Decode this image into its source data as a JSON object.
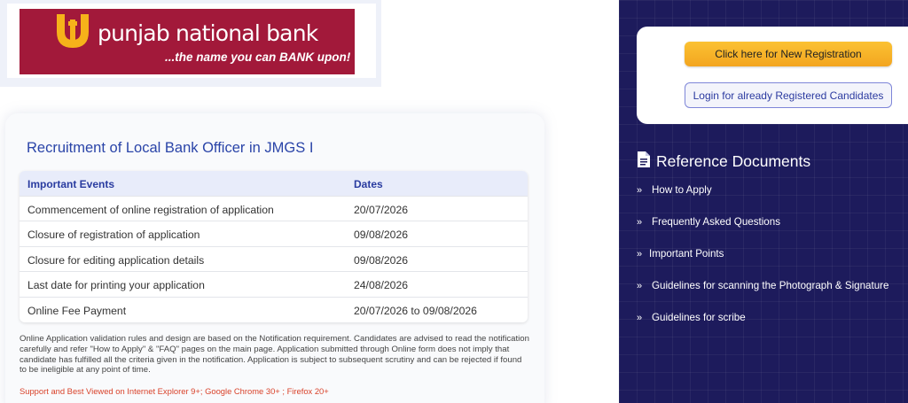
{
  "brand": {
    "name": "punjab national bank",
    "tagline": "...the name you can BANK upon!",
    "color": "#a2193a",
    "emblem_color": "#f6b21a"
  },
  "main": {
    "title": "Recruitment of Local Bank Officer in JMGS I",
    "table": {
      "headers": [
        "Important Events",
        "Dates"
      ],
      "rows": [
        [
          "Commencement of online registration of application",
          "20/07/2026"
        ],
        [
          "Closure of registration of application",
          "09/08/2026"
        ],
        [
          "Closure for editing application details",
          "09/08/2026"
        ],
        [
          "Last date for printing your application",
          "24/08/2026"
        ],
        [
          "Online Fee Payment",
          "20/07/2026 to 09/08/2026"
        ]
      ]
    },
    "note": "Online Application validation rules and design are based on the Notification requirement. Candidates are advised to read the notification carefully and refer \"How to Apply\" & \"FAQ\" pages on the main page. Application submitted through Online form does not imply that candidate has fulfilled all the criteria given in the notification. Application is subject to subsequent scrutiny and can be rejected if found to be ineligible at any point of time.",
    "support": "Support and Best Viewed on Internet Explorer 9+; Google Chrome 30+ ; Firefox 20+"
  },
  "sidebar": {
    "new_registration": "Click here for New Registration",
    "login": "Login for already Registered Candidates",
    "ref_title": "Reference Documents",
    "ref_icon": "document-icon",
    "links": [
      "How to Apply",
      "Frequently Asked Questions",
      "Important Points",
      "Guidelines for scanning the Photograph & Signature",
      "Guidelines for scribe"
    ]
  },
  "colors": {
    "sidebar_bg": "#1d1b5c",
    "accent_blue": "#2a44a8",
    "button_yellow": "#f7b52a",
    "support_red": "#d9432b"
  }
}
